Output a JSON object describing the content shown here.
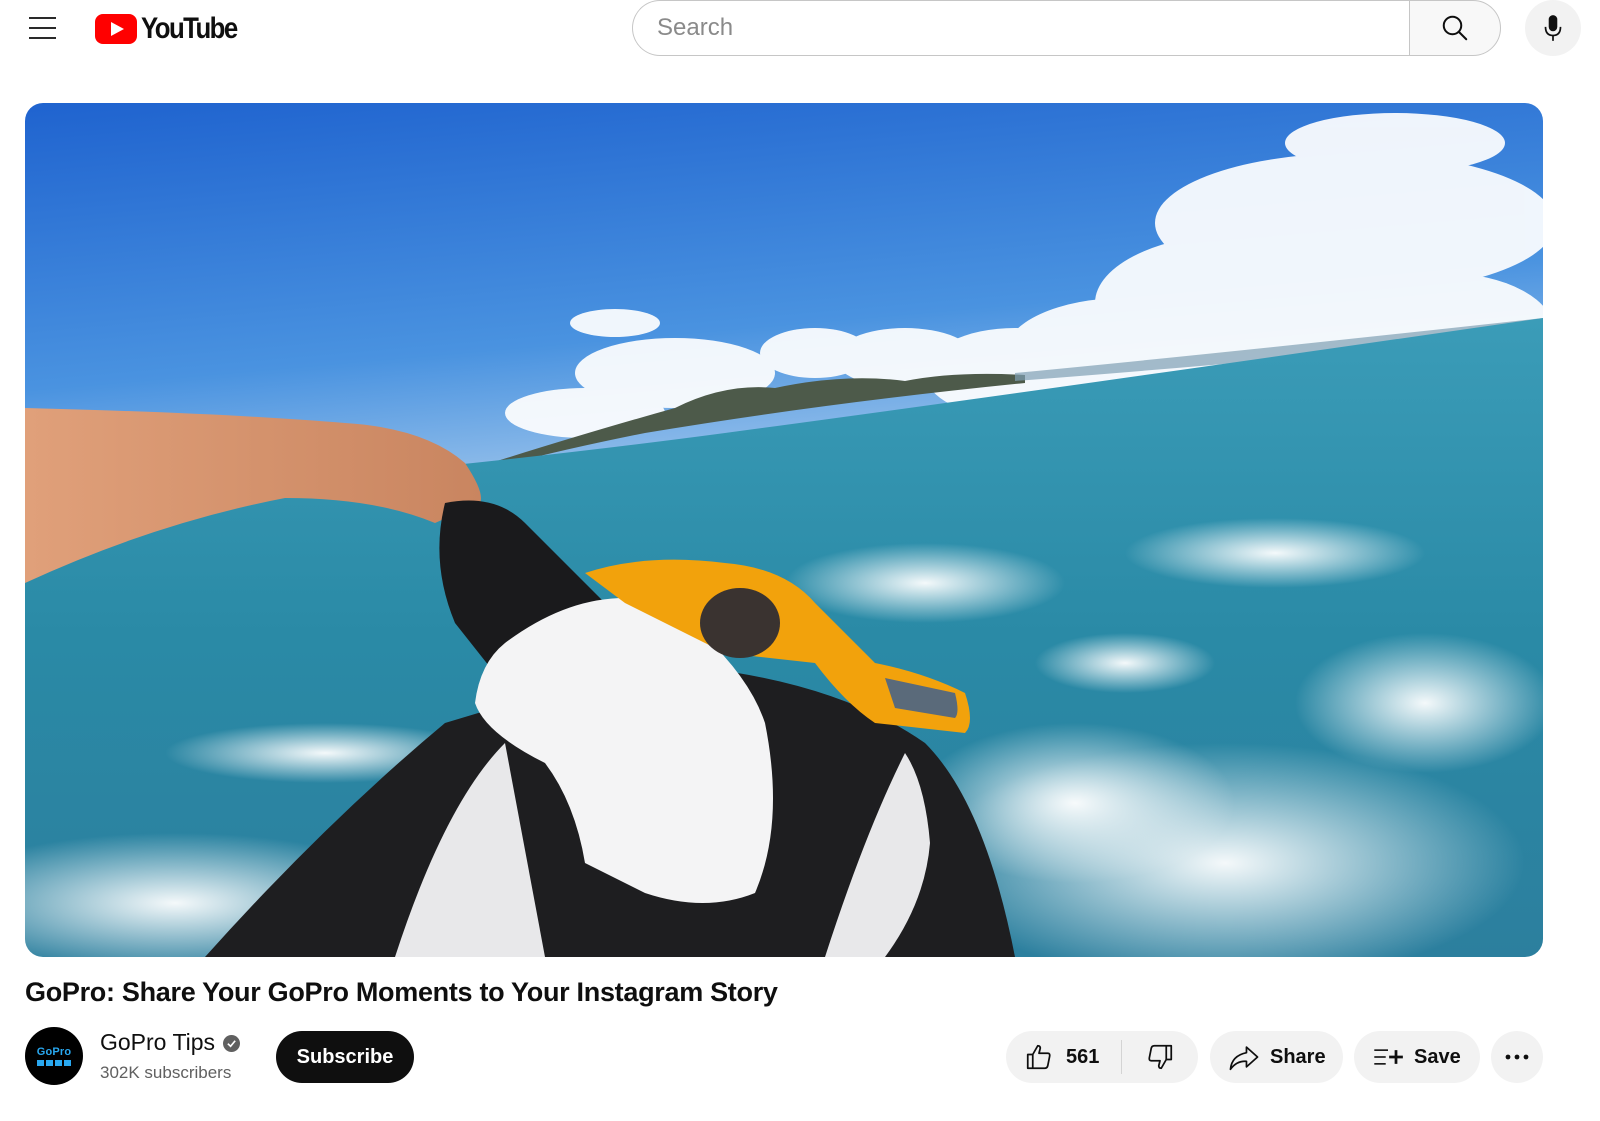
{
  "header": {
    "logo_text": "YouTube",
    "search_placeholder": "Search",
    "search_value": "",
    "icons": {
      "menu": "hamburger-menu-icon",
      "logo": "youtube-play-icon",
      "search": "search-icon",
      "mic": "microphone-icon"
    }
  },
  "video": {
    "title": "GoPro: Share Your GoPro Moments to Your Instagram Story",
    "thumbnail_description": "First-person view of riding a jet ski on turquoise sea with island and clouds",
    "colors": {
      "sky_top": "#2c6fd6",
      "sky_bottom": "#a9cbee",
      "sea": "#2a8fa8",
      "jetski_accent": "#f2a20c"
    }
  },
  "channel": {
    "name": "GoPro Tips",
    "verified": true,
    "subscribers": "302K subscribers",
    "avatar_text": "GoPro",
    "subscribe_label": "Subscribe"
  },
  "actions": {
    "like_count": "561",
    "share_label": "Share",
    "save_label": "Save",
    "more_label": "..."
  },
  "colors": {
    "brand_red": "#ff0000",
    "text_primary": "#0f0f0f",
    "text_secondary": "#606060",
    "pill_bg": "#f2f2f2",
    "gopro_blue": "#29a8f0"
  }
}
